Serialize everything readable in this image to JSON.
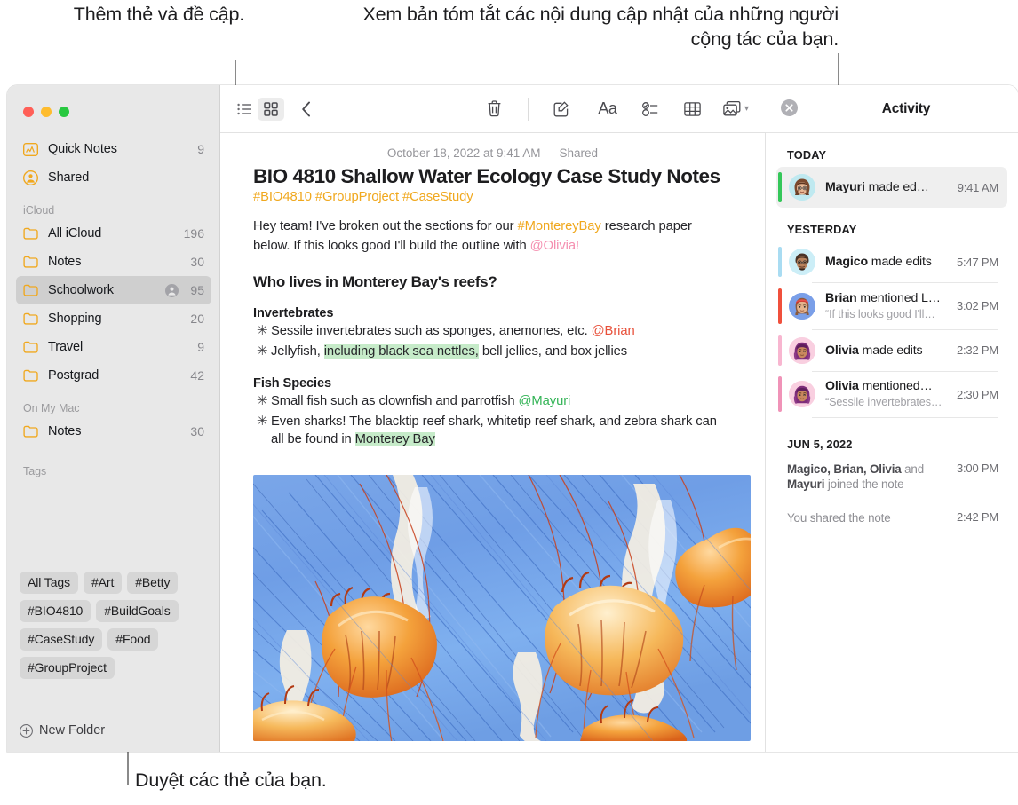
{
  "callouts": {
    "tags": "Thêm thẻ và đề cập.",
    "activity": "Xem bản tóm tắt các nội dung cập nhật của những người cộng tác của bạn.",
    "browse": "Duyệt các thẻ của bạn."
  },
  "sidebar": {
    "top_items": [
      {
        "label": "Quick Notes",
        "count": "9",
        "icon": "quick-note-icon"
      },
      {
        "label": "Shared",
        "count": "",
        "icon": "shared-person-icon"
      }
    ],
    "sections": [
      {
        "header": "iCloud",
        "items": [
          {
            "label": "All iCloud",
            "count": "196",
            "icon": "folder-icon",
            "selected": false,
            "shared": false
          },
          {
            "label": "Notes",
            "count": "30",
            "icon": "folder-icon",
            "selected": false,
            "shared": false
          },
          {
            "label": "Schoolwork",
            "count": "95",
            "icon": "folder-icon",
            "selected": true,
            "shared": true
          },
          {
            "label": "Shopping",
            "count": "20",
            "icon": "folder-icon",
            "selected": false,
            "shared": false
          },
          {
            "label": "Travel",
            "count": "9",
            "icon": "folder-icon",
            "selected": false,
            "shared": false
          },
          {
            "label": "Postgrad",
            "count": "42",
            "icon": "folder-icon",
            "selected": false,
            "shared": false
          }
        ]
      },
      {
        "header": "On My Mac",
        "items": [
          {
            "label": "Notes",
            "count": "30",
            "icon": "folder-icon",
            "selected": false,
            "shared": false
          }
        ]
      }
    ],
    "tags_header": "Tags",
    "tags": [
      "All Tags",
      "#Art",
      "#Betty",
      "#BIO4810",
      "#BuildGoals",
      "#CaseStudy",
      "#Food",
      "#GroupProject"
    ],
    "new_folder_label": "New Folder"
  },
  "toolbar": {
    "buttons": [
      {
        "name": "list-view-icon",
        "active": false
      },
      {
        "name": "gallery-view-icon",
        "active": true
      },
      {
        "name": "back-chevron-icon",
        "active": false
      },
      {
        "name": "trash-icon",
        "active": false
      },
      {
        "name": "compose-icon",
        "active": false
      },
      {
        "name": "format-aa-icon",
        "active": false
      },
      {
        "name": "checklist-icon",
        "active": false
      },
      {
        "name": "table-icon",
        "active": false
      },
      {
        "name": "media-icon",
        "active": false
      },
      {
        "name": "link-icon",
        "active": false
      },
      {
        "name": "lock-icon",
        "active": false
      },
      {
        "name": "add-people-icon",
        "active": false
      },
      {
        "name": "share-icon",
        "active": false
      },
      {
        "name": "search-icon",
        "active": false
      }
    ],
    "format_label": "Aa"
  },
  "note": {
    "date": "October 18, 2022 at 9:41 AM — Shared",
    "title": "BIO 4810 Shallow Water Ecology Case Study Notes",
    "tags_line": "#BIO4810 #GroupProject #CaseStudy",
    "intro": {
      "p1a": "Hey team! I've broken out the sections for our ",
      "hash": "#MontereyBay",
      "p1b": " research paper below. If this looks good I'll build the outline with ",
      "mention": "@Olivia!"
    },
    "heading": "Who lives in Monterey Bay's reefs?",
    "groups": [
      {
        "subheading": "Invertebrates",
        "bullets": [
          {
            "mark": "✳",
            "parts": [
              {
                "t": "Sessile invertebrates such as sponges, anemones, etc. ",
                "style": "plain"
              },
              {
                "t": "@Brian",
                "style": "mention-red"
              }
            ]
          },
          {
            "mark": "✳",
            "parts": [
              {
                "t": "Jellyfish, ",
                "style": "plain"
              },
              {
                "t": "including black sea nettles,",
                "style": "highlight"
              },
              {
                "t": " bell jellies, and box jellies",
                "style": "plain"
              }
            ]
          }
        ]
      },
      {
        "subheading": "Fish Species",
        "bullets": [
          {
            "mark": "✳",
            "parts": [
              {
                "t": "Small fish such as clownfish and parrotfish ",
                "style": "plain"
              },
              {
                "t": "@Mayuri",
                "style": "mention-green"
              }
            ]
          },
          {
            "mark": "✳",
            "parts": [
              {
                "t": "Even sharks! The blacktip reef shark, whitetip reef shark, and zebra shark can all be found in ",
                "style": "plain"
              },
              {
                "t": "Monterey Bay",
                "style": "highlight"
              }
            ]
          }
        ]
      }
    ],
    "photo_alt": "jellyfish-photo"
  },
  "activity": {
    "title": "Activity",
    "close_label": "×",
    "groups": [
      {
        "day": "TODAY",
        "entries": [
          {
            "actor": "Mayuri",
            "action": " made ed…",
            "quote": "",
            "time": "9:41 AM",
            "bar_color": "#34c759",
            "avatar_bg": "#bfe9f0",
            "selected": true
          }
        ]
      },
      {
        "day": "YESTERDAY",
        "entries": [
          {
            "actor": "Magico",
            "action": " made edits",
            "quote": "",
            "time": "5:47 PM",
            "bar_color": "#a9dcf2",
            "avatar_bg": "#cceef7",
            "selected": false
          },
          {
            "actor": "Brian",
            "action": " mentioned L…",
            "quote": "“If this looks good I'll…",
            "time": "3:02 PM",
            "bar_color": "#f0503c",
            "avatar_bg": "#7a9fe8",
            "selected": false
          },
          {
            "actor": "Olivia",
            "action": " made edits",
            "quote": "",
            "time": "2:32 PM",
            "bar_color": "#f8b6d0",
            "avatar_bg": "#f9cfe0",
            "selected": false
          },
          {
            "actor": "Olivia",
            "action": " mentioned…",
            "quote": "“Sessile invertebrates…",
            "time": "2:30 PM",
            "bar_color": "#f093b8",
            "avatar_bg": "#f9cfe0",
            "selected": false
          }
        ]
      }
    ],
    "history_day": "JUN 5, 2022",
    "history": [
      {
        "bold1": "Magico, Brian, Olivia",
        "mid": " and ",
        "bold2": "Mayuri",
        "tail": " joined the note",
        "time": "3:00 PM"
      },
      {
        "bold1": "",
        "mid": "You shared the note",
        "bold2": "",
        "tail": "",
        "time": "2:42 PM"
      }
    ]
  },
  "colors": {
    "accent_orange": "#f0a81e",
    "mention_pink": "#f58fb0",
    "mention_red": "#e8503a",
    "mention_green": "#34b457",
    "highlight_green": "#c6ebc9",
    "selection_gray": "#cfcfcf"
  }
}
